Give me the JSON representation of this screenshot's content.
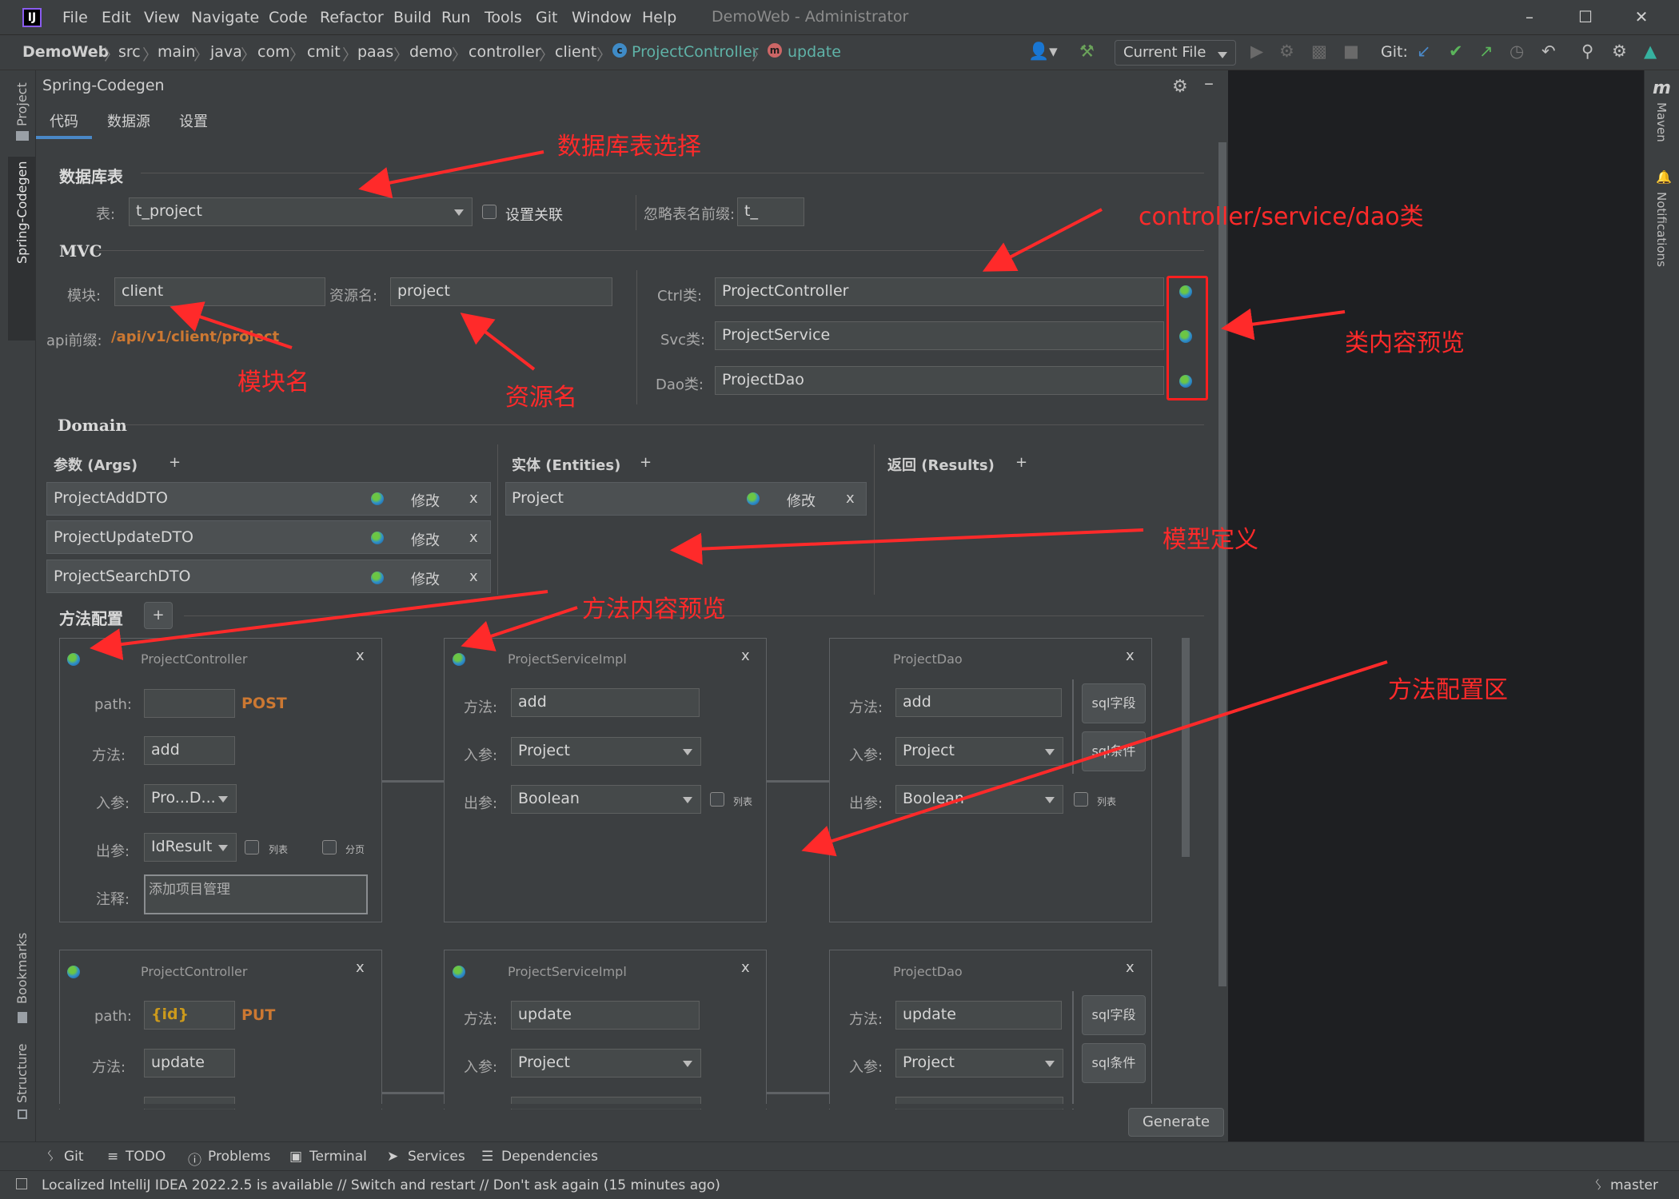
{
  "app": {
    "title": "DemoWeb - Administrator",
    "logo": "IJ"
  },
  "menu": [
    "File",
    "Edit",
    "View",
    "Navigate",
    "Code",
    "Refactor",
    "Build",
    "Run",
    "Tools",
    "Git",
    "Window",
    "Help"
  ],
  "breadcrumb": [
    "DemoWeb",
    "src",
    "main",
    "java",
    "com",
    "cmit",
    "paas",
    "demo",
    "controller",
    "client",
    "ProjectController",
    "update"
  ],
  "toolbar": {
    "run_config": "Current File",
    "git_label": "Git:"
  },
  "left_tools": {
    "project": "Project",
    "codegen": "Spring-Codegen",
    "bookmarks": "Bookmarks",
    "structure": "Structure"
  },
  "right_tools": {
    "maven": "Maven",
    "notifications": "Notifications"
  },
  "panel": {
    "title": "Spring-Codegen",
    "tabs": [
      "代码",
      "数据源",
      "设置"
    ]
  },
  "db": {
    "section": "数据库表",
    "table_label": "表:",
    "table_value": "t_project",
    "relation_label": "设置关联",
    "prefix_label": "忽略表名前缀:",
    "prefix_value": "t_"
  },
  "mvc": {
    "section": "MVC",
    "module_label": "模块:",
    "module_value": "client",
    "resource_label": "资源名:",
    "resource_value": "project",
    "api_label": "api前缀:",
    "api_value": "/api/v1/client/project",
    "ctrl_label": "Ctrl类:",
    "ctrl_value": "ProjectController",
    "svc_label": "Svc类:",
    "svc_value": "ProjectService",
    "dao_label": "Dao类:",
    "dao_value": "ProjectDao"
  },
  "domain": {
    "section": "Domain",
    "args_title": "参数 (Args)",
    "entities_title": "实体 (Entities)",
    "results_title": "返回 (Results)",
    "add": "+",
    "edit": "修改",
    "close": "x",
    "args": [
      "ProjectAddDTO",
      "ProjectUpdateDTO",
      "ProjectSearchDTO"
    ],
    "entities": [
      "Project"
    ]
  },
  "methods": {
    "section": "方法配置",
    "add": "+",
    "labels": {
      "path": "path:",
      "method": "方法:",
      "in": "入参:",
      "out": "出参:",
      "comment": "注释:",
      "list": "列表",
      "page": "分页",
      "sql_field": "sql字段",
      "sql_cond": "sql条件",
      "close": "x"
    },
    "row1": {
      "ctrl_title": "ProjectController",
      "path": "",
      "http": "POST",
      "ctrl_method": "add",
      "ctrl_in": "Pro...D...",
      "ctrl_out": "IdResult",
      "comment": "添加项目管理",
      "svc_title": "ProjectServiceImpl",
      "svc_method": "add",
      "svc_in": "Project",
      "svc_out": "Boolean",
      "dao_title": "ProjectDao",
      "dao_method": "add",
      "dao_in": "Project",
      "dao_out": "Boolean"
    },
    "row2": {
      "ctrl_title": "ProjectController",
      "path": "{id}",
      "http": "PUT",
      "ctrl_method": "update",
      "svc_title": "ProjectServiceImpl",
      "svc_method": "update",
      "svc_in": "Project",
      "dao_title": "ProjectDao",
      "dao_method": "update",
      "dao_in": "Project"
    }
  },
  "generate": "Generate",
  "annotations": {
    "table_select": "数据库表选择",
    "classes": "controller/service/dao类",
    "preview": "类内容预览",
    "module": "模块名",
    "resource": "资源名",
    "model": "模型定义",
    "method_preview": "方法内容预览",
    "method_area": "方法配置区"
  },
  "bottom_tabs": [
    "Git",
    "TODO",
    "Problems",
    "Terminal",
    "Services",
    "Dependencies"
  ],
  "status": {
    "message": "Localized IntelliJ IDEA 2022.2.5 is available // Switch and restart // Don't ask again (15 minutes ago)",
    "branch": "master"
  },
  "colors": {
    "accent": "#4a88c7",
    "annotation": "#ff2a2a",
    "http": "#cc7832"
  }
}
